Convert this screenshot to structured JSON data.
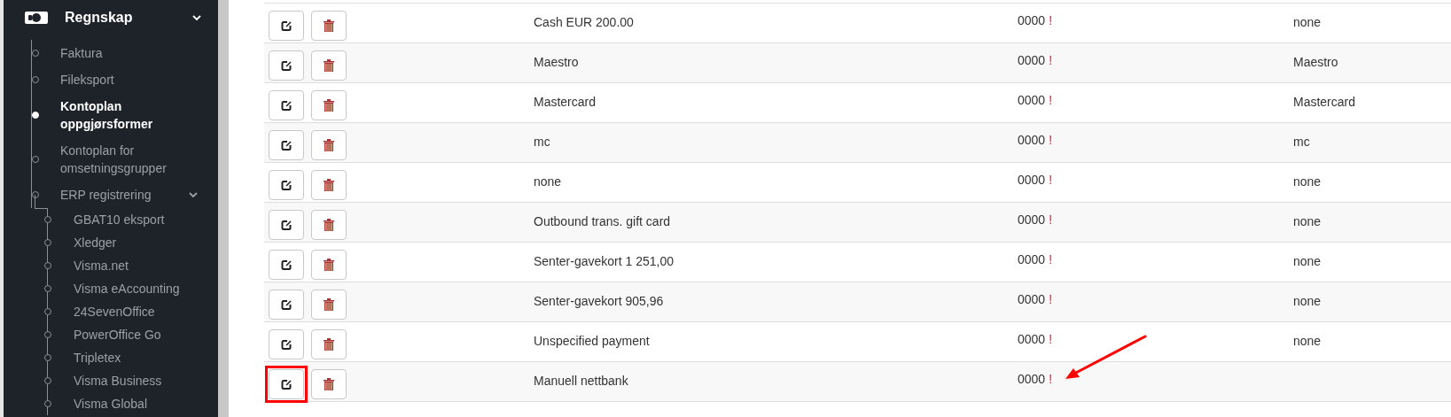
{
  "sidebar": {
    "section": {
      "title": "Regnskap",
      "expanded": true
    },
    "items": [
      {
        "label": "Faktura",
        "selected": false
      },
      {
        "label": "Fileksport",
        "selected": false
      },
      {
        "label": "Kontoplan oppgjørsformer",
        "selected": true
      },
      {
        "label": "Kontoplan for omsetningsgrupper",
        "selected": false
      },
      {
        "label": "ERP registrering",
        "selected": false,
        "expanded": true,
        "children": [
          {
            "label": "GBAT10 eksport",
            "selected": false
          },
          {
            "label": "Xledger",
            "selected": false
          },
          {
            "label": "Visma.net",
            "selected": false
          },
          {
            "label": "Visma eAccounting",
            "selected": false
          },
          {
            "label": "24SevenOffice",
            "selected": false
          },
          {
            "label": "PowerOffice Go",
            "selected": false
          },
          {
            "label": "Tripletex",
            "selected": false
          },
          {
            "label": "Visma Business",
            "selected": false
          },
          {
            "label": "Visma Global",
            "selected": false
          }
        ]
      }
    ]
  },
  "table": {
    "rows": [
      {
        "name": "Cash EUR 200.00",
        "code": "0000",
        "flag": "!",
        "column_4": "none",
        "highlighted": false
      },
      {
        "name": "Maestro",
        "code": "0000",
        "flag": "!",
        "column_4": "Maestro",
        "highlighted": false
      },
      {
        "name": "Mastercard",
        "code": "0000",
        "flag": "!",
        "column_4": "Mastercard",
        "highlighted": false
      },
      {
        "name": "mc",
        "code": "0000",
        "flag": "!",
        "column_4": "mc",
        "highlighted": false
      },
      {
        "name": "none",
        "code": "0000",
        "flag": "!",
        "column_4": "none",
        "highlighted": false
      },
      {
        "name": "Outbound trans. gift card",
        "code": "0000",
        "flag": "!",
        "column_4": "none",
        "highlighted": false
      },
      {
        "name": "Senter-gavekort 1 251,00",
        "code": "0000",
        "flag": "!",
        "column_4": "none",
        "highlighted": false
      },
      {
        "name": "Senter-gavekort 905,96",
        "code": "0000",
        "flag": "!",
        "column_4": "none",
        "highlighted": false
      },
      {
        "name": "Unspecified payment",
        "code": "0000",
        "flag": "!",
        "column_4": "none",
        "highlighted": false
      },
      {
        "name": "Manuell nettbank",
        "code": "0000",
        "flag": "!",
        "highlighted": true
      }
    ]
  }
}
